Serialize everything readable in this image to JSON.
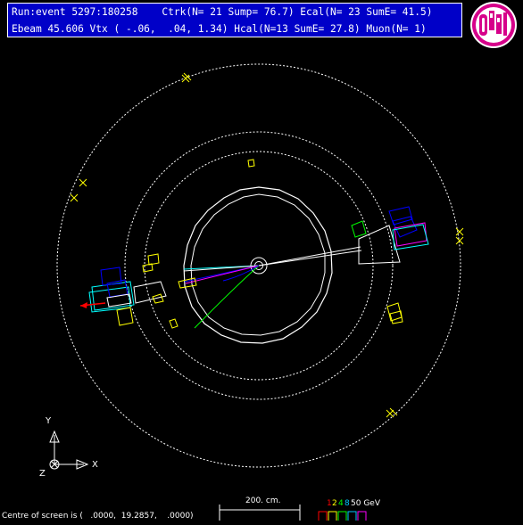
{
  "header": {
    "line1": "Run:event 5297:180258    Ctrk(N= 21 Sump= 76.7) Ecal(N= 23 SumE= 41.5)",
    "line2": "Ebeam 45.606 Vtx ( -.06,  .04, 1.34) Hcal(N=13 SumE= 27.8) Muon(N= 1)"
  },
  "logo": {
    "text": "OPAL"
  },
  "axes": {
    "y": "Y",
    "x": "X",
    "z": "Z"
  },
  "scale": {
    "label": "200. cm."
  },
  "energy_scale": {
    "labels": [
      "1",
      "2",
      "4",
      "8",
      "50 GeV"
    ],
    "colors": [
      "#ff0000",
      "#ffff00",
      "#00ff00",
      "#00c8ff",
      "#ffffff"
    ]
  },
  "footer": {
    "text": "Centre of screen is (   .0000,  19.2857,    .0000)"
  },
  "colors": {
    "background": "#000000",
    "header_bg": "#0000c8",
    "tracks": "#00ffff",
    "ecal": "#00ff00",
    "hcal": "#0000ff",
    "muon": "#ff0000",
    "logo": "#d6008a"
  }
}
